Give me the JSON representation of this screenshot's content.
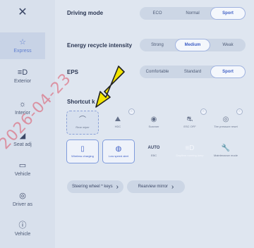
{
  "sidebar": {
    "close_icon": "close-icon",
    "items": [
      {
        "label": "Express",
        "icon": "star-icon",
        "active": true
      },
      {
        "label": "Exterior",
        "icon": "car-lights-icon"
      },
      {
        "label": "Interior",
        "icon": "interior-light-icon"
      },
      {
        "label": "Seat adj",
        "icon": "seat-icon"
      },
      {
        "label": "Vehicle",
        "icon": "vehicle-icon"
      },
      {
        "label": "Driver as",
        "icon": "driver-assist-icon"
      },
      {
        "label": "Vehicle",
        "icon": "vehicle-info-icon"
      }
    ]
  },
  "driving_mode": {
    "label": "Driving mode",
    "options": [
      "ECO",
      "Normal",
      "Sport"
    ],
    "selected": "Sport"
  },
  "energy_recycle": {
    "label": "Energy recycle intensity",
    "options": [
      "Strong",
      "Medium",
      "Weak"
    ],
    "selected": "Medium"
  },
  "eps": {
    "label": "EPS",
    "options": [
      "Comfortable",
      "Standard",
      "Sport"
    ],
    "selected": "Sport"
  },
  "shortcut": {
    "label": "Shortcut k",
    "tiles_row1": [
      {
        "label": "Rear wiper",
        "style": "dashed"
      },
      {
        "label": "HDC",
        "badge": true
      },
      {
        "label": "Scanner"
      },
      {
        "label": "ESC OFF",
        "badge": true
      },
      {
        "label": "Tire pressure reset",
        "badge": true
      }
    ],
    "tiles_row2": [
      {
        "label": "Wireless charging",
        "style": "active"
      },
      {
        "label": "Low speed alert",
        "style": "active"
      },
      {
        "label": "EBC",
        "icon_text": "AUTO"
      },
      {
        "label": "Daytime running lamp"
      },
      {
        "label": "Maintenance mode"
      }
    ]
  },
  "links": {
    "steering": "Steering wheel * keys",
    "rearview": "Rearview mirror"
  },
  "watermark": "2026-04-23",
  "colors": {
    "accent": "#3e5fc6",
    "arrow": "#f2e400",
    "watermark": "#dc5064"
  }
}
